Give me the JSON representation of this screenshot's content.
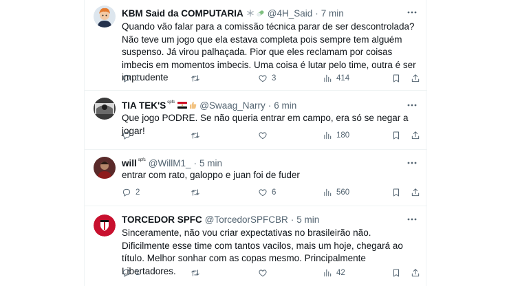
{
  "tweets": [
    {
      "name": "KBM Said da COMPUTARIA",
      "badge": "",
      "handle": "@4H_Said",
      "time": "7 min",
      "emoji": [
        "❄",
        "💊"
      ],
      "text": "Quando vão falar para a comissão técnica parar de ser descontrolada? Não teve um jogo que ela estava completa pois sempre tem alguém suspenso. Já virou palhaçada. Pior que eles reclamam por coisas imbecis em momentos imbecis. Uma coisa é lutar pelo time, outra é ser imprudente",
      "replies": "1",
      "retweets": "",
      "likes": "3",
      "views": "414"
    },
    {
      "name": "TIA TEK'S",
      "badge": "spfc",
      "handle": "@Swaag_Narry",
      "time": "6 min",
      "emoji": [
        "flag-egypt",
        "👍"
      ],
      "text": "Que jogo PODRE. Se não queria entrar em campo, era só se negar a jogar!",
      "replies": "",
      "retweets": "",
      "likes": "",
      "views": "180"
    },
    {
      "name": "will",
      "badge": "spfc",
      "handle": "@WillM1_",
      "time": "5 min",
      "emoji": [],
      "text": "entrar com rato, galoppo e juan foi de fuder",
      "replies": "2",
      "retweets": "",
      "likes": "6",
      "views": "560"
    },
    {
      "name": "TORCEDOR SPFC",
      "badge": "",
      "handle": "@TorcedorSPFCBR",
      "time": "5 min",
      "emoji": [],
      "text": "Sinceramente, não vou criar expectativas no brasileirão não. Dificilmente esse time com tantos vacilos, mais um hoje, chegará ao título. Melhor sonhar com as copas mesmo. Principalmente Libertadores.",
      "replies": "1",
      "retweets": "",
      "likes": "",
      "views": "42"
    }
  ],
  "dot": "·",
  "icons": {
    "more": "more-horizontal-icon",
    "reply": "reply-icon",
    "retweet": "retweet-icon",
    "like": "heart-icon",
    "views": "views-chart-icon",
    "bookmark": "bookmark-icon",
    "share": "share-icon"
  }
}
